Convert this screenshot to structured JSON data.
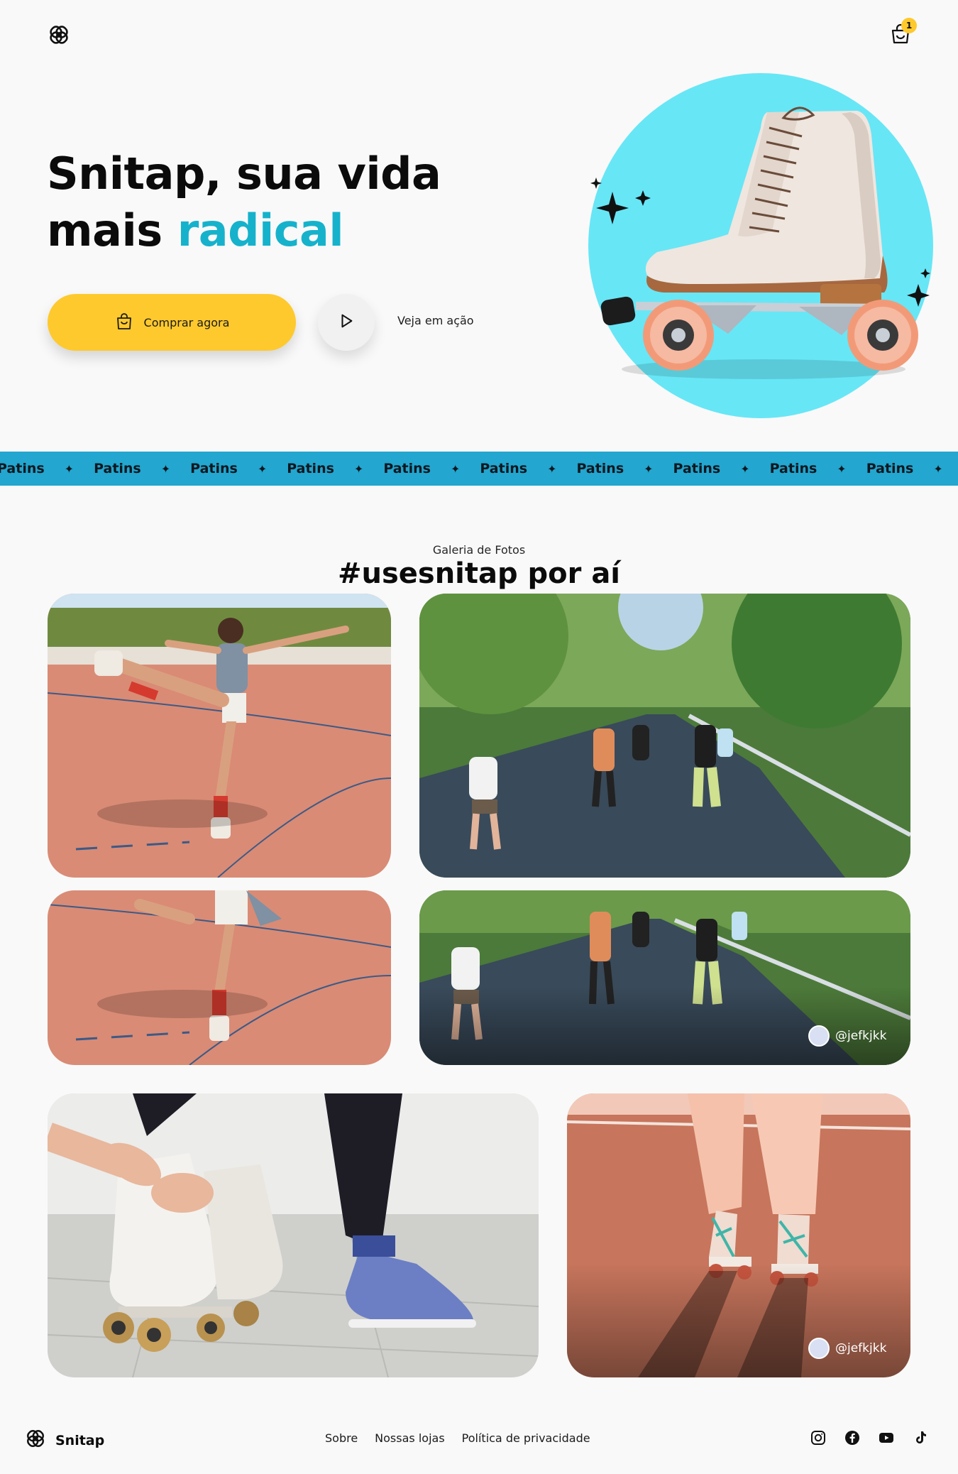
{
  "header": {
    "logo_icon": "snitap-logo-icon",
    "cart_icon": "shopping-bag-icon",
    "cart_count": "1"
  },
  "hero": {
    "title_line1": "Snitap, sua vida",
    "title_line2_plain": "mais ",
    "title_line2_accent": "radical",
    "accent_color": "#16b2cc",
    "buy_label": "Comprar agora",
    "buy_icon": "shopping-bag-icon",
    "buy_color": "#fec92d",
    "play_icon": "play-icon",
    "see_action_label": "Veja em ação",
    "art": "roller-skate-on-cyan-circle"
  },
  "marquee": {
    "items": [
      "Patins",
      "Patins",
      "Patins",
      "Patins",
      "Patins",
      "Patins",
      "Patins",
      "Patins",
      "Patins",
      "Patins",
      "Patins"
    ],
    "separator": "✦",
    "color": "#23a6cf"
  },
  "gallery": {
    "label": "Galeria de Fotos",
    "title": "#usesnitap por aí",
    "photos": [
      {
        "alt": "woman skating on red court",
        "user": ""
      },
      {
        "alt": "group skating in park",
        "user": ""
      },
      {
        "alt": "woman skating on red court detail",
        "user": ""
      },
      {
        "alt": "group skating in park detail",
        "user": "@jefkjkk"
      },
      {
        "alt": "tying white roller skates",
        "user": ""
      },
      {
        "alt": "skater legs with teal laces",
        "user": "@jefkjkk"
      }
    ]
  },
  "footer": {
    "brand": "Snitap",
    "links": [
      "Sobre",
      "Nossas lojas",
      "Política de privacidade"
    ],
    "socials": [
      "instagram-icon",
      "facebook-icon",
      "youtube-icon",
      "tiktok-icon"
    ]
  }
}
